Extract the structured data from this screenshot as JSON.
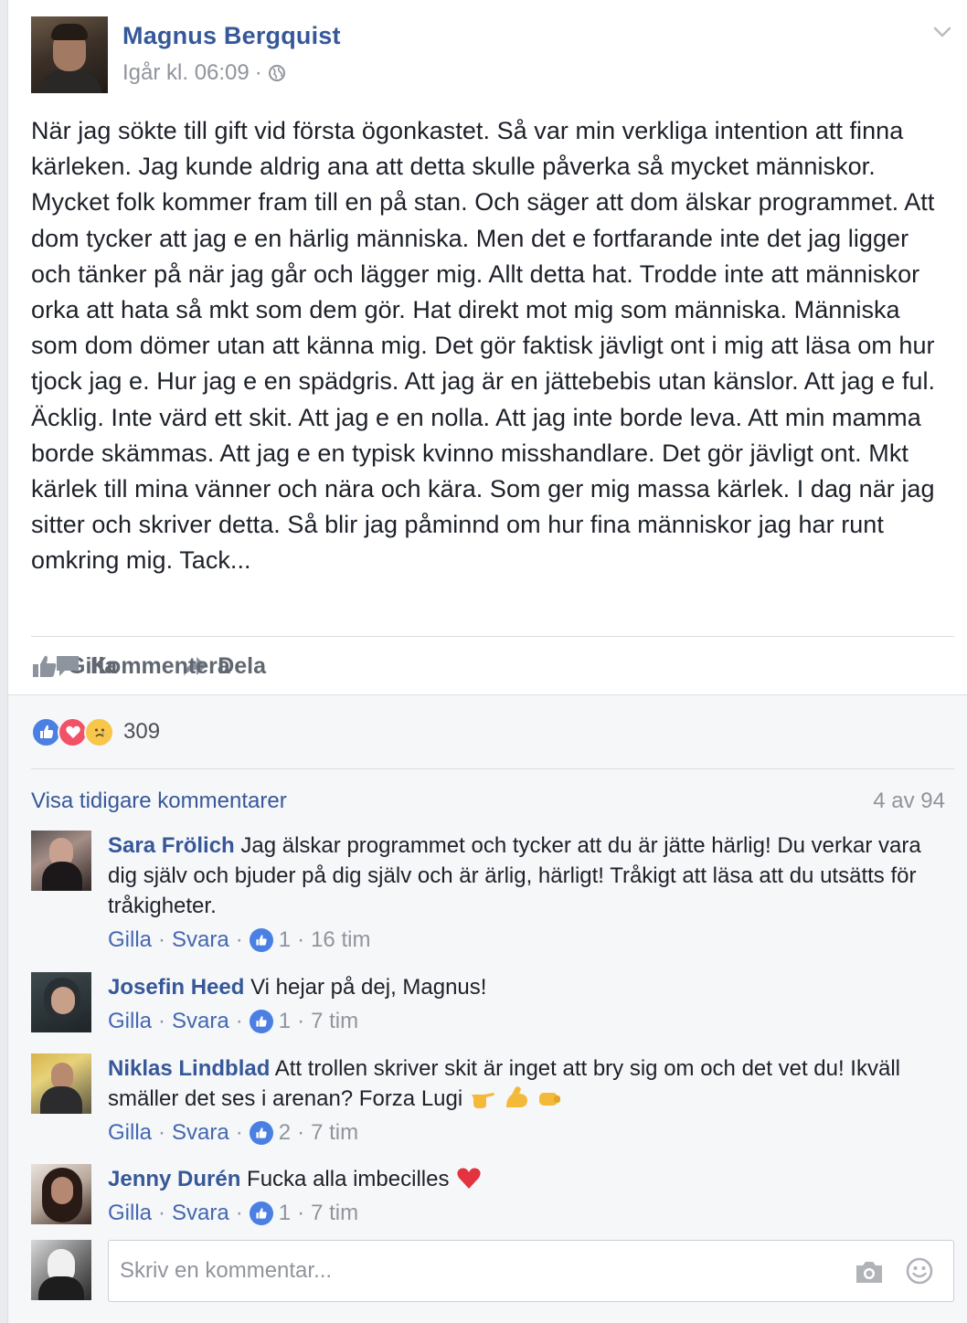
{
  "post": {
    "author": "Magnus Bergquist",
    "timestamp": "Igår kl. 06:09",
    "meta_separator": "·",
    "privacy_icon": "globe-icon",
    "menu_icon": "chevron-down-icon",
    "text": "När jag sökte till gift vid första ögonkastet. Så var min verkliga intention att finna kärleken. Jag kunde aldrig ana att detta skulle påverka så mycket människor. Mycket folk kommer fram till en på stan. Och säger att dom älskar programmet. Att dom tycker att jag e en härlig människa. Men det e fortfarande inte det jag ligger och tänker på när jag går och lägger mig. Allt detta hat. Trodde inte att människor orka att hata så mkt som dem gör. Hat direkt mot mig som människa. Människa som dom dömer utan att känna mig. Det gör faktisk jävligt ont i mig att läsa om hur tjock jag e. Hur jag e en spädgris. Att jag är en jättebebis utan känslor. Att jag e ful. Äcklig. Inte värd ett skit. Att jag e en nolla. Att jag inte borde leva. Att min mamma borde skämmas. Att jag e en typisk kvinno misshandlare. Det gör jävligt ont. Mkt kärlek till mina vänner och nära och kära. Som ger mig massa kärlek. I dag när jag sitter och skriver detta. Så blir jag påminnd om hur fina människor jag har runt omkring mig. Tack..."
  },
  "actions": {
    "like": "Gilla",
    "comment": "Kommentera",
    "share": "Dela"
  },
  "reactions": {
    "count": "309",
    "types": [
      "like",
      "love",
      "sad"
    ]
  },
  "comments_header": {
    "previous": "Visa tidigare kommentarer",
    "count": "4 av 94"
  },
  "comments": [
    {
      "name": "Sara Frölich",
      "text": "Jag älskar programmet och tycker att du är jätte härlig! Du verkar vara dig själv och bjuder på dig själv och är ärlig, härligt! Tråkigt att läsa att du utsätts för tråkigheter.",
      "like_label": "Gilla",
      "reply_label": "Svara",
      "likes": "1",
      "time": "16 tim"
    },
    {
      "name": "Josefin Heed",
      "text": "Vi hejar på dej, Magnus!",
      "like_label": "Gilla",
      "reply_label": "Svara",
      "likes": "1",
      "time": "7 tim"
    },
    {
      "name": "Niklas Lindblad",
      "text": "Att trollen skriver skit är inget att bry sig om och det vet du! Ikväll smäller det ses i arenan? Forza Lugi",
      "like_label": "Gilla",
      "reply_label": "Svara",
      "likes": "2",
      "time": "7 tim"
    },
    {
      "name": "Jenny Durén",
      "text": "Fucka alla imbecilles",
      "like_label": "Gilla",
      "reply_label": "Svara",
      "likes": "1",
      "time": "7 tim"
    }
  ],
  "compose": {
    "placeholder": "Skriv en kommentar..."
  },
  "colors": {
    "link": "#365899",
    "meta": "#90949c",
    "like_blue": "#4a7fe3",
    "love_red": "#f25268",
    "sad_yellow": "#f7c64b"
  }
}
